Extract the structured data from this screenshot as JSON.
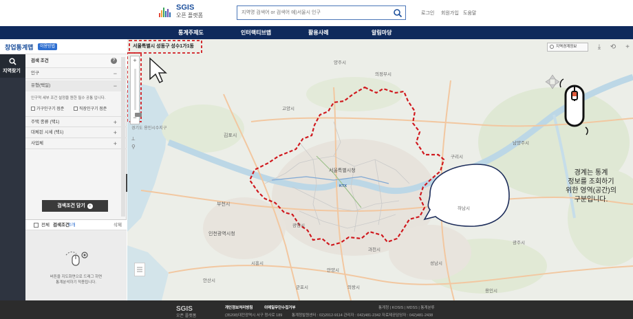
{
  "header": {
    "logo_title": "SGIS",
    "logo_sub": "오픈 플랫폼",
    "search_placeholder": "지역명 검색어 or 검색어 예)서울시 인구",
    "links": [
      "로그인",
      "회원가입",
      "도움말"
    ]
  },
  "nav": {
    "items": [
      "통계주제도",
      "인터랙티브맵",
      "활용사례",
      "알림마당"
    ]
  },
  "page": {
    "title": "창업통계맵",
    "guide_badge": "이용방법"
  },
  "sidebar": {
    "area_search_label": "지역찾기"
  },
  "panel": {
    "condition_title": "검색 조건",
    "help": "?",
    "rows": [
      {
        "label": "인구",
        "sign": "−"
      },
      {
        "label": "유형(택일)",
        "sign": "−"
      }
    ],
    "description": "인구적 세부 조건 설정을 원한 필수 공통 입니다.",
    "checkboxes": [
      "가구인구기 점준",
      "직장인구기 점준"
    ],
    "more_rows": [
      "주택 종류 (택1)",
      "대체된 시세 (택1)",
      "사업체"
    ],
    "open_button": "검색조건 담기",
    "list_all": "전체",
    "list_title": "검색조건",
    "list_count": "0개",
    "list_delete": "삭제",
    "empty_text_1": "버튼을 지도화면으로 드래그 하면",
    "empty_text_2": "통계분석하기 적용됩니다."
  },
  "map": {
    "address": "서울특별시 성동구 성수1가1동",
    "boundary_button": "지역경계정보",
    "scale_label": "경기도 용인시수지구",
    "callout_line1": "경계는 통계",
    "callout_line2": "정보를 조회하기",
    "callout_line3": "위한 영역(공간)의",
    "callout_line4": "구분입니다.",
    "zoom_in": "+",
    "zoom_out": "−",
    "place_labels": [
      "김포시",
      "부천시",
      "인천광역시청",
      "서울특별시청",
      "광명시",
      "시흥시",
      "안양시",
      "성남시",
      "하남시",
      "구리시",
      "남양주시",
      "고양시",
      "의정부시",
      "양주시",
      "과천시",
      "의왕시",
      "군포시",
      "안산시",
      "용인시",
      "광주시",
      "KTX"
    ]
  },
  "footer": {
    "logo": "SGIS",
    "logo_sub": "오픈 플랫폼",
    "links": [
      "개인정보처리방침",
      "이메일무단수집거부"
    ],
    "right_links": "통계청 | KOSIS | MDSS | 통계분류",
    "address": "(35208)대전광역시 서구 청사로 189",
    "contacts": "통계청발원센터 : 02)2012-9114    관리자 : 042)481-2342    자료제공담당자 : 042)481-2438"
  },
  "colors": {
    "nav_bg": "#0f2a5c",
    "accent": "#1b4f9c",
    "boundary": "#d0191e",
    "footer_bg": "#2c2c2c"
  },
  "icons": [
    "search-icon",
    "help-icon",
    "zoom-in-icon",
    "zoom-out-icon",
    "mouse-icon",
    "cursor-icon",
    "download-icon",
    "share-icon",
    "plus-icon"
  ]
}
